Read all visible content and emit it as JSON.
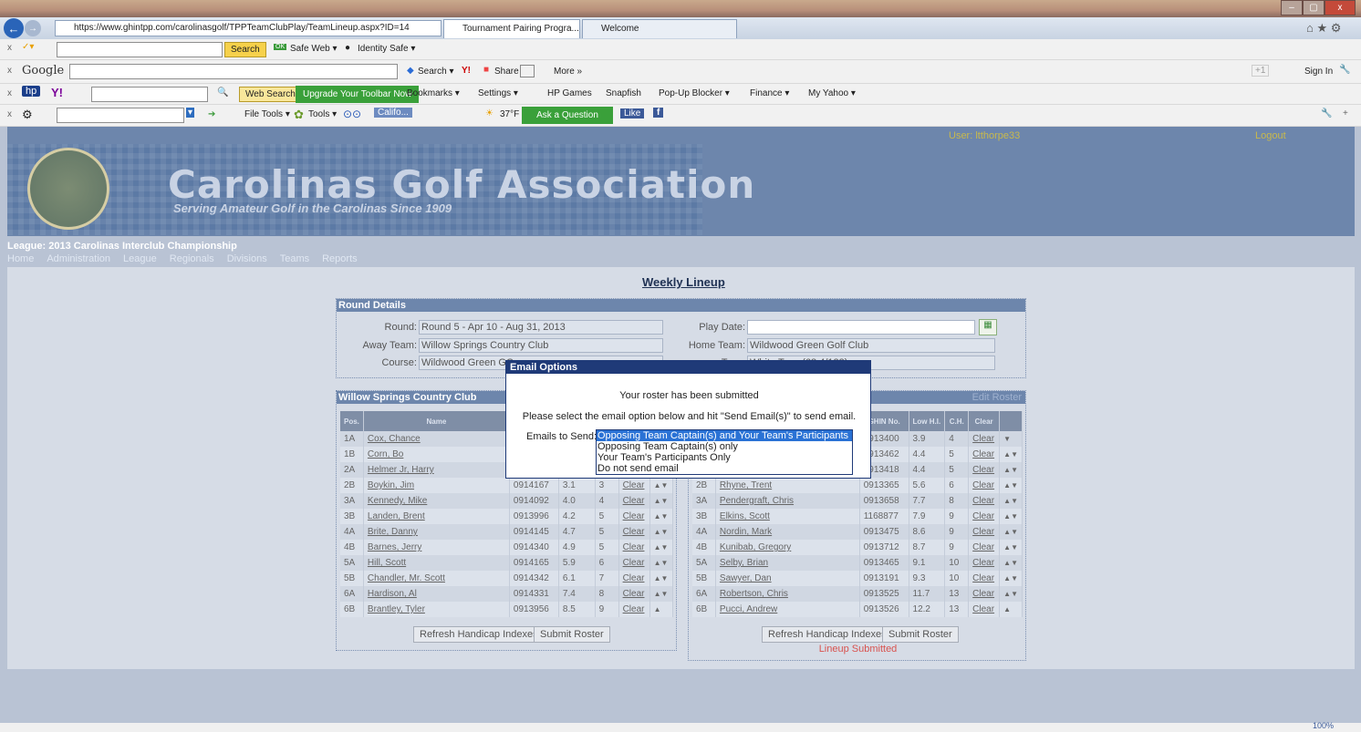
{
  "browser": {
    "url": "https://www.ghintpp.com/carolinasgolf/TPPTeamClubPlay/TeamLineup.aspx?ID=14",
    "tabs": [
      "Tournament Pairing Progra...",
      "Welcome"
    ],
    "window_controls": [
      "–",
      "▢",
      "x"
    ]
  },
  "toolbar1": {
    "search_btn": "Search",
    "safe_web": "Safe Web ▾",
    "identity_safe": "Identity Safe ▾"
  },
  "toolbar2": {
    "brand": "Google",
    "search": "Search ▾",
    "share": "Share",
    "more": "More »",
    "sign_in": "Sign In",
    "gplus": "+1"
  },
  "toolbar3": {
    "web_search": "Web Search",
    "upgrade": "Upgrade Your Toolbar Now",
    "bookmarks": "Bookmarks ▾",
    "settings": "Settings ▾",
    "hp_games": "HP Games",
    "snapfish": "Snapfish",
    "popup_blocker": "Pop-Up Blocker ▾",
    "finance": "Finance ▾",
    "my_yahoo": "My Yahoo ▾"
  },
  "toolbar4": {
    "file_tools": "File Tools ▾",
    "tools": "Tools ▾",
    "weather_loc": "Califo...",
    "temp": "37°F",
    "ask": "Ask a Question",
    "like": "Like"
  },
  "site": {
    "title": "Carolinas Golf Association",
    "subtitle": "Serving Amateur Golf in the Carolinas Since 1909",
    "user": "User: ltthorpe33",
    "logout": "Logout",
    "league": "League: 2013 Carolinas Interclub Championship",
    "menu": [
      "Home",
      "Administration",
      "League",
      "Regionals",
      "Divisions",
      "Teams",
      "Reports"
    ]
  },
  "page_title": "Weekly Lineup",
  "round_details": {
    "heading": "Round Details",
    "round_label": "Round:",
    "round": "Round 5 - Apr 10 - Aug 31, 2013",
    "away_label": "Away Team:",
    "away": "Willow Springs Country Club",
    "course_label": "Course:",
    "course": "Wildwood Green GC",
    "playdate_label": "Play Date:",
    "playdate": "",
    "home_label": "Home Team:",
    "home": "Wildwood Green Golf Club",
    "tees_label": "Tees:",
    "tees": "White Tees (68.4/123)"
  },
  "columns": [
    "Pos.",
    "Name",
    "GHIN No.",
    "Low H.I.",
    "C.H.",
    "Clear"
  ],
  "away_panel": {
    "heading": "Willow Springs Country Club",
    "rows": [
      {
        "pos": "1A",
        "name": "Cox, Chance",
        "ghin": "",
        "hi": "",
        "ch": "",
        "clear": "Clear"
      },
      {
        "pos": "1B",
        "name": "Corn, Bo",
        "ghin": "",
        "hi": "",
        "ch": "",
        "clear": "Clear"
      },
      {
        "pos": "2A",
        "name": "Helmer Jr, Harry",
        "ghin": "",
        "hi": "",
        "ch": "",
        "clear": "Clear"
      },
      {
        "pos": "2B",
        "name": "Boykin, Jim",
        "ghin": "0914167",
        "hi": "3.1",
        "ch": "3",
        "clear": "Clear"
      },
      {
        "pos": "3A",
        "name": "Kennedy, Mike",
        "ghin": "0914092",
        "hi": "4.0",
        "ch": "4",
        "clear": "Clear"
      },
      {
        "pos": "3B",
        "name": "Landen, Brent",
        "ghin": "0913996",
        "hi": "4.2",
        "ch": "5",
        "clear": "Clear"
      },
      {
        "pos": "4A",
        "name": "Brite, Danny",
        "ghin": "0914145",
        "hi": "4.7",
        "ch": "5",
        "clear": "Clear"
      },
      {
        "pos": "4B",
        "name": "Barnes, Jerry",
        "ghin": "0914340",
        "hi": "4.9",
        "ch": "5",
        "clear": "Clear"
      },
      {
        "pos": "5A",
        "name": "Hill, Scott",
        "ghin": "0914165",
        "hi": "5.9",
        "ch": "6",
        "clear": "Clear"
      },
      {
        "pos": "5B",
        "name": "Chandler, Mr. Scott",
        "ghin": "0914342",
        "hi": "6.1",
        "ch": "7",
        "clear": "Clear"
      },
      {
        "pos": "6A",
        "name": "Hardison, Al",
        "ghin": "0914331",
        "hi": "7.4",
        "ch": "8",
        "clear": "Clear"
      },
      {
        "pos": "6B",
        "name": "Brantley, Tyler",
        "ghin": "0913956",
        "hi": "8.5",
        "ch": "9",
        "clear": "Clear"
      }
    ],
    "refresh": "Refresh Handicap Indexes",
    "submit": "Submit Roster"
  },
  "home_panel": {
    "heading": "",
    "link": "Edit Roster",
    "rows": [
      {
        "pos": "1A",
        "name": "",
        "ghin": "0913400",
        "hi": "3.9",
        "ch": "4",
        "clear": "Clear"
      },
      {
        "pos": "1B",
        "name": "",
        "ghin": "0913462",
        "hi": "4.4",
        "ch": "5",
        "clear": "Clear"
      },
      {
        "pos": "2A",
        "name": "",
        "ghin": "0913418",
        "hi": "4.4",
        "ch": "5",
        "clear": "Clear"
      },
      {
        "pos": "2B",
        "name": "Rhyne, Trent",
        "ghin": "0913365",
        "hi": "5.6",
        "ch": "6",
        "clear": "Clear"
      },
      {
        "pos": "3A",
        "name": "Pendergraft, Chris",
        "ghin": "0913658",
        "hi": "7.7",
        "ch": "8",
        "clear": "Clear"
      },
      {
        "pos": "3B",
        "name": "Elkins, Scott",
        "ghin": "1168877",
        "hi": "7.9",
        "ch": "9",
        "clear": "Clear"
      },
      {
        "pos": "4A",
        "name": "Nordin, Mark",
        "ghin": "0913475",
        "hi": "8.6",
        "ch": "9",
        "clear": "Clear"
      },
      {
        "pos": "4B",
        "name": "Kunibab, Gregory",
        "ghin": "0913712",
        "hi": "8.7",
        "ch": "9",
        "clear": "Clear"
      },
      {
        "pos": "5A",
        "name": "Selby, Brian",
        "ghin": "0913465",
        "hi": "9.1",
        "ch": "10",
        "clear": "Clear"
      },
      {
        "pos": "5B",
        "name": "Sawyer, Dan",
        "ghin": "0913191",
        "hi": "9.3",
        "ch": "10",
        "clear": "Clear"
      },
      {
        "pos": "6A",
        "name": "Robertson, Chris",
        "ghin": "0913525",
        "hi": "11.7",
        "ch": "13",
        "clear": "Clear"
      },
      {
        "pos": "6B",
        "name": "Pucci, Andrew",
        "ghin": "0913526",
        "hi": "12.2",
        "ch": "13",
        "clear": "Clear"
      }
    ],
    "refresh": "Refresh Handicap Indexes",
    "submit": "Submit Roster",
    "status": "Lineup Submitted"
  },
  "modal": {
    "title": "Email Options",
    "msg1": "Your roster has been submitted",
    "msg2": "Please select the email option below and hit \"Send Email(s)\" to send email.",
    "label": "Emails to Send:",
    "options": [
      "Opposing Team Captain(s) and Your Team's Participants",
      "Opposing Team Captain(s) only",
      "Your Team's Participants Only",
      "Do not send email"
    ]
  },
  "zoom": "100%",
  "colors": {
    "accent": "#1f3a78",
    "header": "#6d86ac",
    "selected": "#2a72d5",
    "status_red": "#d9534f"
  }
}
